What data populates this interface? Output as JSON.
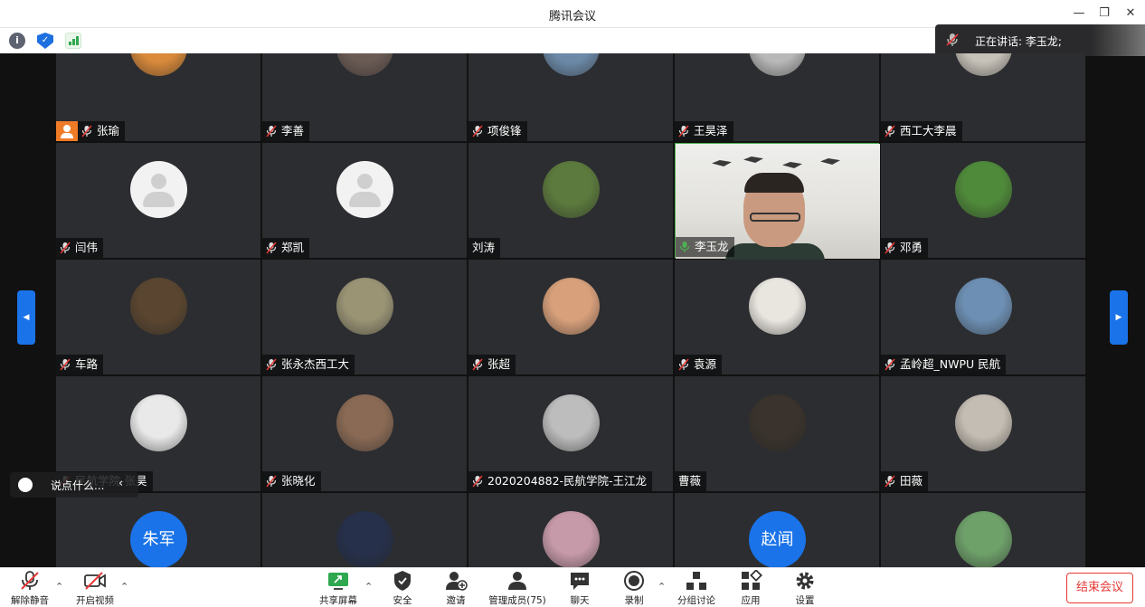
{
  "window": {
    "title": "腾讯会议"
  },
  "speaking": {
    "text": "正在讲话: 李玉龙;"
  },
  "chat": {
    "placeholder": "说点什么..."
  },
  "participants": [
    {
      "name": "张瑜",
      "mic": "muted",
      "host": true,
      "avatar": "photo",
      "color": "#d98a3b"
    },
    {
      "name": "李善",
      "mic": "muted",
      "avatar": "photo",
      "color": "#6b5b55"
    },
    {
      "name": "项俊锋",
      "mic": "muted",
      "avatar": "photo",
      "color": "#6c8aa8"
    },
    {
      "name": "王昊泽",
      "mic": "muted",
      "avatar": "photo",
      "color": "#b8b8b8"
    },
    {
      "name": "西工大李晨",
      "mic": "muted",
      "avatar": "photo",
      "color": "#c7c2b9"
    },
    {
      "name": "闫伟",
      "mic": "muted",
      "avatar": "default"
    },
    {
      "name": "郑凯",
      "mic": "muted",
      "avatar": "default"
    },
    {
      "name": "刘涛",
      "mic": "none",
      "avatar": "photo",
      "color": "#5c7a3d"
    },
    {
      "name": "李玉龙",
      "mic": "active",
      "avatar": "video"
    },
    {
      "name": "邓勇",
      "mic": "muted",
      "avatar": "photo",
      "color": "#4f8a3a"
    },
    {
      "name": "车路",
      "mic": "muted",
      "avatar": "photo",
      "color": "#5a4630"
    },
    {
      "name": "张永杰西工大",
      "mic": "muted",
      "avatar": "photo",
      "color": "#9a9475"
    },
    {
      "name": "张超",
      "mic": "muted",
      "avatar": "photo",
      "color": "#d8a07b"
    },
    {
      "name": "袁源",
      "mic": "muted",
      "avatar": "photo",
      "color": "#e9e6e0"
    },
    {
      "name": "孟岭超_NWPU 民航",
      "mic": "muted",
      "avatar": "photo",
      "color": "#6d8fb3"
    },
    {
      "name": "民航学院-张昊",
      "mic": "muted",
      "avatar": "photo",
      "color": "#e9e9e9"
    },
    {
      "name": "张晓化",
      "mic": "muted",
      "avatar": "photo",
      "color": "#8a6a55"
    },
    {
      "name": "2020204882-民航学院-王江龙",
      "mic": "muted",
      "avatar": "photo",
      "color": "#bdbdbd"
    },
    {
      "name": "曹薇",
      "mic": "none",
      "avatar": "photo",
      "color": "#3a332d"
    },
    {
      "name": "田薇",
      "mic": "muted",
      "avatar": "photo",
      "color": "#c4bdb3"
    },
    {
      "name": "",
      "mic": "none",
      "avatar": "text",
      "avatar_text": "朱军"
    },
    {
      "name": "",
      "mic": "none",
      "avatar": "photo",
      "color": "#26304a"
    },
    {
      "name": "",
      "mic": "none",
      "avatar": "photo",
      "color": "#c79aa9"
    },
    {
      "name": "",
      "mic": "none",
      "avatar": "text",
      "avatar_text": "赵闻"
    },
    {
      "name": "",
      "mic": "none",
      "avatar": "photo",
      "color": "#6ea06a"
    }
  ],
  "toolbar": {
    "unmute": "解除静音",
    "start_video": "开启视频",
    "share_screen": "共享屏幕",
    "security": "安全",
    "invite": "邀请",
    "manage_members": "管理成员(75)",
    "chat": "聊天",
    "record": "录制",
    "breakout": "分组讨论",
    "apps": "应用",
    "settings": "设置",
    "end_meeting": "结束会议"
  },
  "colors": {
    "accent": "#1a73e8",
    "end": "#e53935",
    "host": "#f07b26",
    "active_mic": "#4caf50"
  }
}
